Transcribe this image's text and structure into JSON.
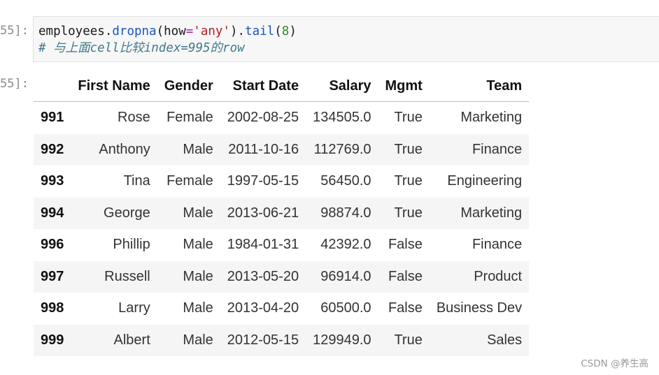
{
  "prompts": {
    "input": "55]:",
    "output": "55]:"
  },
  "code": {
    "t1": "employees",
    "t2": ".",
    "t3": "dropna",
    "t4": "(",
    "t5": "how",
    "t6": "=",
    "t7": "'any'",
    "t8": ").",
    "t9": "tail",
    "t10": "(",
    "t11": "8",
    "t12": ")",
    "comment": "# 与上面cell比较index=995的row"
  },
  "table": {
    "columns": [
      "",
      "First Name",
      "Gender",
      "Start Date",
      "Salary",
      "Mgmt",
      "Team"
    ],
    "rows": [
      {
        "index": "991",
        "first_name": "Rose",
        "gender": "Female",
        "start_date": "2002-08-25",
        "salary": "134505.0",
        "mgmt": "True",
        "team": "Marketing"
      },
      {
        "index": "992",
        "first_name": "Anthony",
        "gender": "Male",
        "start_date": "2011-10-16",
        "salary": "112769.0",
        "mgmt": "True",
        "team": "Finance"
      },
      {
        "index": "993",
        "first_name": "Tina",
        "gender": "Female",
        "start_date": "1997-05-15",
        "salary": "56450.0",
        "mgmt": "True",
        "team": "Engineering"
      },
      {
        "index": "994",
        "first_name": "George",
        "gender": "Male",
        "start_date": "2013-06-21",
        "salary": "98874.0",
        "mgmt": "True",
        "team": "Marketing"
      },
      {
        "index": "996",
        "first_name": "Phillip",
        "gender": "Male",
        "start_date": "1984-01-31",
        "salary": "42392.0",
        "mgmt": "False",
        "team": "Finance"
      },
      {
        "index": "997",
        "first_name": "Russell",
        "gender": "Male",
        "start_date": "2013-05-20",
        "salary": "96914.0",
        "mgmt": "False",
        "team": "Product"
      },
      {
        "index": "998",
        "first_name": "Larry",
        "gender": "Male",
        "start_date": "2013-04-20",
        "salary": "60500.0",
        "mgmt": "False",
        "team": "Business Dev"
      },
      {
        "index": "999",
        "first_name": "Albert",
        "gender": "Male",
        "start_date": "2012-05-15",
        "salary": "129949.0",
        "mgmt": "True",
        "team": "Sales"
      }
    ]
  },
  "watermark": "CSDN @养生高",
  "colors": {
    "method": "#1a55b8",
    "string": "#b02020",
    "number": "#2a8a2a",
    "equals": "#a020a0",
    "comment": "#3f7a8a",
    "cell_background": "#f7f7f7",
    "row_stripe": "#f5f5f5"
  }
}
